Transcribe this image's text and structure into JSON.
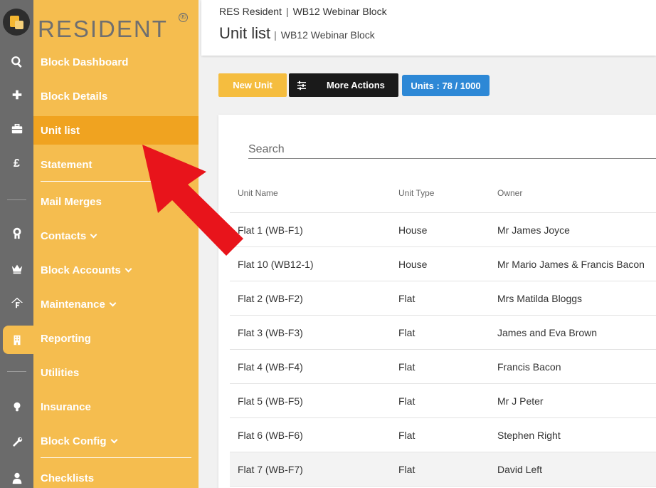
{
  "brand": {
    "name": "RESIDENT",
    "reg_mark": "®"
  },
  "rail_icons": [
    "search-icon",
    "plus-icon",
    "briefcase-icon",
    "pound-icon",
    "menu-icon",
    "contacts-badge-icon",
    "crown-icon",
    "house-tool-icon",
    "building-icon",
    "menu-icon",
    "bulb-icon",
    "wrench-icon",
    "person-icon"
  ],
  "nav": {
    "items": [
      {
        "label": "Block Dashboard"
      },
      {
        "label": "Block Details"
      },
      {
        "label": "Unit list"
      },
      {
        "label": "Statement"
      },
      {
        "label": "Mail Merges"
      },
      {
        "label": "Contacts"
      },
      {
        "label": "Block Accounts"
      },
      {
        "label": "Maintenance"
      },
      {
        "label": "Reporting"
      },
      {
        "label": "Utilities"
      },
      {
        "label": "Insurance"
      },
      {
        "label": "Block Config"
      },
      {
        "label": "Checklists"
      }
    ],
    "active": "Unit list"
  },
  "header": {
    "breadcrumb_1": "RES Resident",
    "breadcrumb_sep": "|",
    "breadcrumb_2": "WB12 Webinar Block",
    "title": "Unit list",
    "title_sep": "|",
    "subtitle": "WB12 Webinar Block"
  },
  "actions": {
    "new_unit": "New Unit",
    "more_actions": "More Actions",
    "units_badge": "Units : 78 / 1000"
  },
  "search": {
    "placeholder": "Search"
  },
  "table": {
    "columns": [
      "Unit Name",
      "Unit Type",
      "Owner"
    ],
    "rows": [
      [
        "Flat 1 (WB-F1)",
        "House",
        "Mr James Joyce"
      ],
      [
        "Flat 10 (WB12-1)",
        "House",
        "Mr Mario James & Francis Bacon"
      ],
      [
        "Flat 2 (WB-F2)",
        "Flat",
        "Mrs Matilda Bloggs"
      ],
      [
        "Flat 3 (WB-F3)",
        "Flat",
        "James and Eva Brown"
      ],
      [
        "Flat 4 (WB-F4)",
        "Flat",
        "Francis Bacon"
      ],
      [
        "Flat 5 (WB-F5)",
        "Flat",
        "Mr J Peter"
      ],
      [
        "Flat 6 (WB-F6)",
        "Flat",
        "Stephen Right"
      ],
      [
        "Flat 7 (WB-F7)",
        "Flat",
        "David Left"
      ]
    ]
  },
  "colors": {
    "nav_bg": "#f5bd4f",
    "nav_active": "#f0a320",
    "rail_bg": "#6b6b6b",
    "new_unit_btn": "#f5bd3f",
    "more_actions_btn": "#1a1a1a",
    "units_badge": "#2d88d6",
    "annotation_arrow": "#e8141b"
  }
}
